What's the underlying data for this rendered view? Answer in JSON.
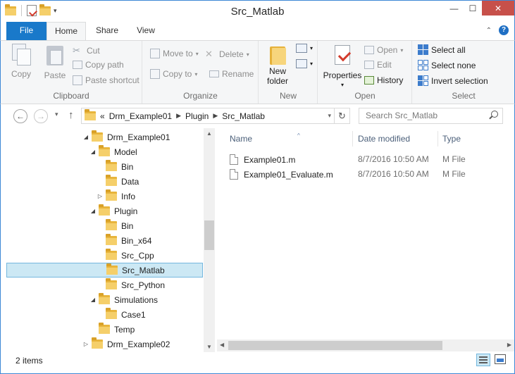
{
  "window": {
    "title": "Src_Matlab"
  },
  "ribbon_tabs": {
    "file": "File",
    "home": "Home",
    "share": "Share",
    "view": "View"
  },
  "ribbon": {
    "clipboard": {
      "label": "Clipboard",
      "copy": "Copy",
      "paste": "Paste",
      "cut": "Cut",
      "copy_path": "Copy path",
      "paste_shortcut": "Paste shortcut"
    },
    "organize": {
      "label": "Organize",
      "move_to": "Move to",
      "copy_to": "Copy to",
      "delete": "Delete",
      "rename": "Rename"
    },
    "new": {
      "label": "New",
      "new_folder_line1": "New",
      "new_folder_line2": "folder"
    },
    "open": {
      "label": "Open",
      "properties": "Properties",
      "open": "Open",
      "edit": "Edit",
      "history": "History"
    },
    "select": {
      "label": "Select",
      "select_all": "Select all",
      "select_none": "Select none",
      "invert_selection": "Invert selection"
    }
  },
  "address": {
    "overflow": "«",
    "crumbs": [
      "Drm_Example01",
      "Plugin",
      "Src_Matlab"
    ],
    "search_placeholder": "Search Src_Matlab"
  },
  "tree": [
    {
      "label": "Drm_Example01",
      "level": 0,
      "expanded": true
    },
    {
      "label": "Model",
      "level": 1,
      "expanded": true
    },
    {
      "label": "Bin",
      "level": 2,
      "expanded": null
    },
    {
      "label": "Data",
      "level": 2,
      "expanded": null
    },
    {
      "label": "Info",
      "level": 2,
      "expanded": false
    },
    {
      "label": "Plugin",
      "level": 1,
      "expanded": true
    },
    {
      "label": "Bin",
      "level": 2,
      "expanded": null
    },
    {
      "label": "Bin_x64",
      "level": 2,
      "expanded": null
    },
    {
      "label": "Src_Cpp",
      "level": 2,
      "expanded": null
    },
    {
      "label": "Src_Matlab",
      "level": 2,
      "expanded": null,
      "selected": true
    },
    {
      "label": "Src_Python",
      "level": 2,
      "expanded": null
    },
    {
      "label": "Simulations",
      "level": 1,
      "expanded": true
    },
    {
      "label": "Case1",
      "level": 2,
      "expanded": null
    },
    {
      "label": "Temp",
      "level": 1,
      "expanded": null
    },
    {
      "label": "Drm_Example02",
      "level": 0,
      "expanded": false
    }
  ],
  "columns": {
    "name": "Name",
    "date": "Date modified",
    "type": "Type"
  },
  "files": [
    {
      "name": "Example01.m",
      "date": "8/7/2016 10:50 AM",
      "type": "M File"
    },
    {
      "name": "Example01_Evaluate.m",
      "date": "8/7/2016 10:50 AM",
      "type": "M File"
    }
  ],
  "status": {
    "items": "2 items"
  },
  "colors": {
    "accent": "#1979ca",
    "folder": "#e8b53c",
    "selection": "#cce8f4",
    "close": "#c7504a"
  }
}
